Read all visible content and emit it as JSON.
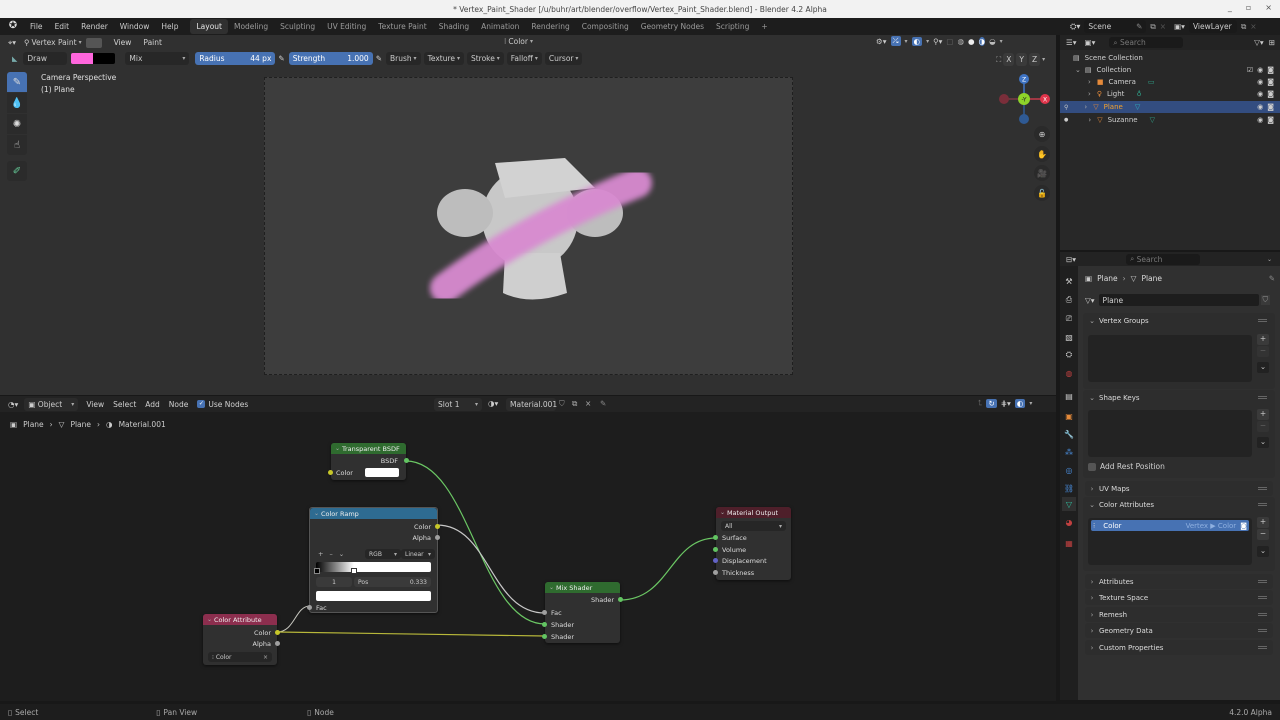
{
  "window": {
    "title": "* Vertex_Paint_Shader [/u/buhr/art/blender/overflow/Vertex_Paint_Shader.blend] - Blender 4.2 Alpha",
    "controls": [
      "_",
      "▫",
      "×"
    ]
  },
  "menu": [
    "File",
    "Edit",
    "Render",
    "Window",
    "Help"
  ],
  "workspaces": [
    {
      "label": "Layout",
      "active": true
    },
    {
      "label": "Modeling"
    },
    {
      "label": "Sculpting"
    },
    {
      "label": "UV Editing"
    },
    {
      "label": "Texture Paint"
    },
    {
      "label": "Shading"
    },
    {
      "label": "Animation"
    },
    {
      "label": "Rendering"
    },
    {
      "label": "Compositing"
    },
    {
      "label": "Geometry Nodes"
    },
    {
      "label": "Scripting"
    }
  ],
  "add_workspace": "+",
  "scene": {
    "label": "Scene",
    "view_layer": "ViewLayer"
  },
  "viewport": {
    "mode": "Vertex Paint",
    "menus": [
      "View",
      "Paint"
    ],
    "color_mode": "Color",
    "overlay_line1": "Camera Perspective",
    "overlay_line2": "(1) Plane",
    "axes": [
      "X",
      "Y",
      "Z"
    ],
    "gizmo": {
      "z": "Z",
      "y": "-Y",
      "x": "X"
    },
    "colors": {
      "paint": "#ff66dd",
      "secondary": "#000000",
      "stroke": "#d88ad0"
    }
  },
  "tool_settings": {
    "tool": "Draw",
    "blend": "Mix",
    "radius_label": "Radius",
    "radius_value": "44 px",
    "strength_label": "Strength",
    "strength_value": "1.000",
    "menus": [
      "Brush",
      "Texture",
      "Stroke",
      "Falloff",
      "Cursor"
    ]
  },
  "outliner": {
    "search_placeholder": "Search",
    "root": "Scene Collection",
    "collection": "Collection",
    "items": [
      {
        "name": "Camera",
        "type": "camera"
      },
      {
        "name": "Light",
        "type": "light"
      },
      {
        "name": "Plane",
        "type": "mesh",
        "selected": true
      },
      {
        "name": "Suzanne",
        "type": "mesh"
      }
    ]
  },
  "properties": {
    "search_placeholder": "Search",
    "breadcrumb": [
      "Plane",
      "Plane"
    ],
    "mesh_name": "Plane",
    "panels": [
      {
        "label": "Vertex Groups",
        "open": true
      },
      {
        "label": "Shape Keys",
        "open": true
      },
      {
        "label": "UV Maps",
        "open": false
      },
      {
        "label": "Color Attributes",
        "open": true
      },
      {
        "label": "Attributes",
        "open": false
      },
      {
        "label": "Texture Space",
        "open": false
      },
      {
        "label": "Remesh",
        "open": false
      },
      {
        "label": "Geometry Data",
        "open": false
      },
      {
        "label": "Custom Properties",
        "open": false
      }
    ],
    "add_rest_position": "Add Rest Position",
    "color_attribute": {
      "name": "Color",
      "domain": "Vertex ▶ Color"
    }
  },
  "node_editor": {
    "type": "Object",
    "menus": [
      "View",
      "Select",
      "Add",
      "Node"
    ],
    "use_nodes_label": "Use Nodes",
    "use_nodes": true,
    "slot": "Slot 1",
    "material": "Material.001",
    "breadcrumb": [
      "Plane",
      "Plane",
      "Material.001"
    ],
    "nodes": {
      "transparent": {
        "title": "Transparent BSDF",
        "output": "BSDF",
        "input": "Color"
      },
      "color_ramp": {
        "title": "Color Ramp",
        "outputs": [
          "Color",
          "Alpha"
        ],
        "mode": "RGB",
        "interp": "Linear",
        "index": "1",
        "pos_label": "Pos",
        "pos_value": "0.333",
        "input": "Fac"
      },
      "color_attribute": {
        "title": "Color Attribute",
        "outputs": [
          "Color",
          "Alpha"
        ],
        "attr": "Color"
      },
      "mix_shader": {
        "title": "Mix Shader",
        "output": "Shader",
        "inputs": [
          "Fac",
          "Shader",
          "Shader"
        ]
      },
      "material_output": {
        "title": "Material Output",
        "target": "All",
        "inputs": [
          "Surface",
          "Volume",
          "Displacement",
          "Thickness"
        ]
      }
    }
  },
  "status_bar": {
    "items": [
      "Select",
      "Pan View",
      "Node"
    ],
    "version": "4.2.0 Alpha"
  }
}
